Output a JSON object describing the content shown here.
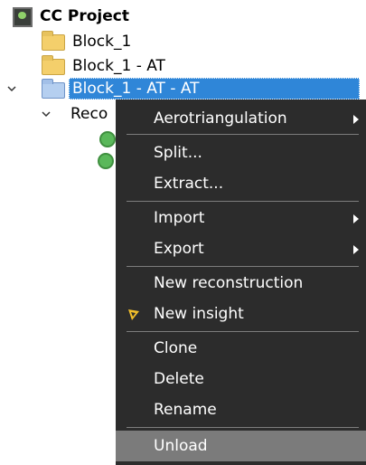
{
  "tree": {
    "root_label": "CC Project",
    "items": [
      {
        "label": "Block_1"
      },
      {
        "label": "Block_1 - AT"
      },
      {
        "label": "Block_1 - AT - AT"
      }
    ],
    "child_label_partial": "Reco"
  },
  "context_menu": {
    "items": [
      {
        "label": "Aerotriangulation",
        "has_submenu": true
      },
      {
        "label": "Split..."
      },
      {
        "label": "Extract..."
      },
      {
        "label": "Import",
        "has_submenu": true
      },
      {
        "label": "Export",
        "has_submenu": true
      },
      {
        "label": "New reconstruction"
      },
      {
        "label": "New insight",
        "icon": "insight-icon"
      },
      {
        "label": "Clone"
      },
      {
        "label": "Delete"
      },
      {
        "label": "Rename"
      },
      {
        "label": "Unload"
      }
    ]
  },
  "colors": {
    "selection": "#2f86d8",
    "menu_background": "#2c2c2c",
    "menu_hover": "#7b7b7b",
    "insight_accent": "#f2bf2b"
  }
}
